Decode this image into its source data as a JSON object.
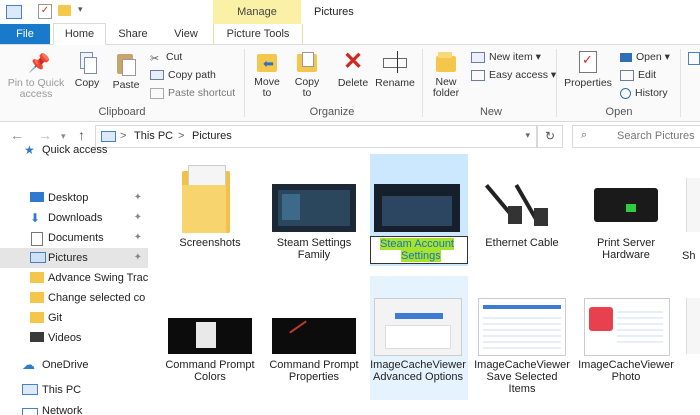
{
  "window": {
    "title": "Pictures",
    "context_tab": "Manage"
  },
  "tabs": {
    "file": "File",
    "home": "Home",
    "share": "Share",
    "view": "View",
    "picture_tools": "Picture Tools"
  },
  "ribbon": {
    "pin": "Pin to Quick access",
    "copy": "Copy",
    "paste": "Paste",
    "cut": "Cut",
    "copy_path": "Copy path",
    "paste_shortcut": "Paste shortcut",
    "clipboard": "Clipboard",
    "move_to": "Move to",
    "copy_to": "Copy to",
    "delete": "Delete",
    "rename": "Rename",
    "organize": "Organize",
    "new_folder": "New folder",
    "new_item": "New item",
    "easy_access": "Easy access",
    "new": "New",
    "properties": "Properties",
    "open_btn": "Open",
    "edit": "Edit",
    "history": "History",
    "open_group": "Open"
  },
  "address": {
    "this_pc": "This PC",
    "sep": ">",
    "current": "Pictures",
    "search_placeholder": "Search Pictures"
  },
  "nav": {
    "quick_access": "Quick access",
    "items": [
      "Desktop",
      "Downloads",
      "Documents",
      "Pictures",
      "Advance Swing Trac",
      "Change selected co",
      "Git",
      "Videos"
    ],
    "onedrive": "OneDrive",
    "this_pc": "This PC",
    "network": "Network"
  },
  "files": {
    "row1": [
      "Screenshots",
      "Steam Settings Family",
      "Steam Account Settings",
      "Ethernet Cable",
      "Print Server Hardware",
      "Sh"
    ],
    "row2": [
      "Command Prompt Colors",
      "Command Prompt Properties",
      "ImageCacheViewer Advanced Options",
      "ImageCacheViewer Save Selected Items",
      "ImageCacheViewer Photo",
      ""
    ]
  },
  "rename_value_line1": "Steam Account",
  "rename_value_line2": "Settings",
  "colors": {
    "accent": "#1979ca",
    "manage": "#fbf1a6",
    "selected": "#cce8ff"
  }
}
